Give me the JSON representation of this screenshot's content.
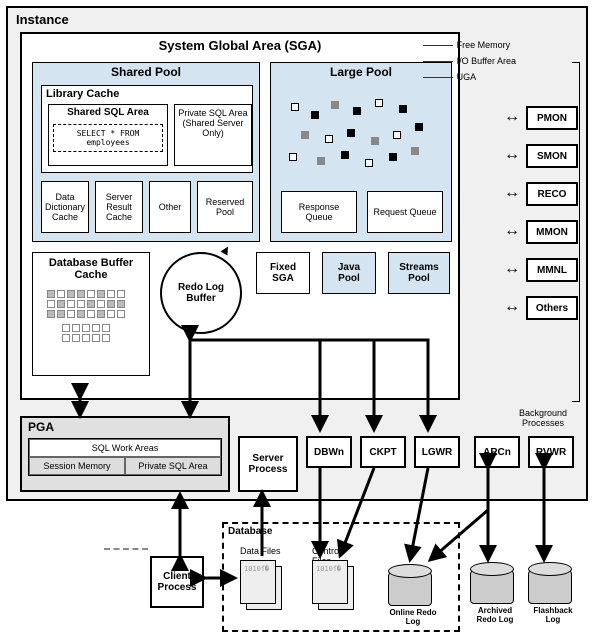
{
  "instance": {
    "title": "Instance"
  },
  "sga": {
    "title": "System Global Area (SGA)",
    "shared_pool": {
      "title": "Shared Pool",
      "library_cache": {
        "title": "Library Cache",
        "shared_sql": {
          "title": "Shared SQL Area",
          "stmt": "SELECT * FROM employees"
        },
        "private_sql": "Private SQL Area (Shared Server Only)"
      },
      "ddc": "Data Dictionary Cache",
      "src": "Server Result Cache",
      "other": "Other",
      "reserved": "Reserved Pool"
    },
    "large_pool": {
      "title": "Large Pool",
      "response": "Response Queue",
      "request": "Request Queue"
    },
    "dbc": {
      "title": "Database Buffer Cache"
    },
    "redo": "Redo Log Buffer",
    "fixed": "Fixed SGA",
    "java": "Java Pool",
    "streams": "Streams Pool"
  },
  "legend": {
    "free": "Free Memory",
    "io": "I/O Buffer Area",
    "uga": "UGA"
  },
  "bg_processes": {
    "label": "Background Processes",
    "list": [
      "PMON",
      "SMON",
      "RECO",
      "MMON",
      "MMNL",
      "Others"
    ]
  },
  "pga": {
    "title": "PGA",
    "work": "SQL Work Areas",
    "session": "Session Memory",
    "priv": "Private SQL Area"
  },
  "server_process": "Server Process",
  "writers": {
    "dbwn": "DBWn",
    "ckpt": "CKPT",
    "lgwr": "LGWR",
    "arcn": "ARCn",
    "rvwr": "RVWR"
  },
  "client": "Client Process",
  "database": {
    "title": "Database",
    "data_files": "Data Files",
    "control_files": "Control Files",
    "online_redo": "Online Redo Log",
    "archived_redo": "Archived Redo Log",
    "flashback": "Flashback Log"
  }
}
